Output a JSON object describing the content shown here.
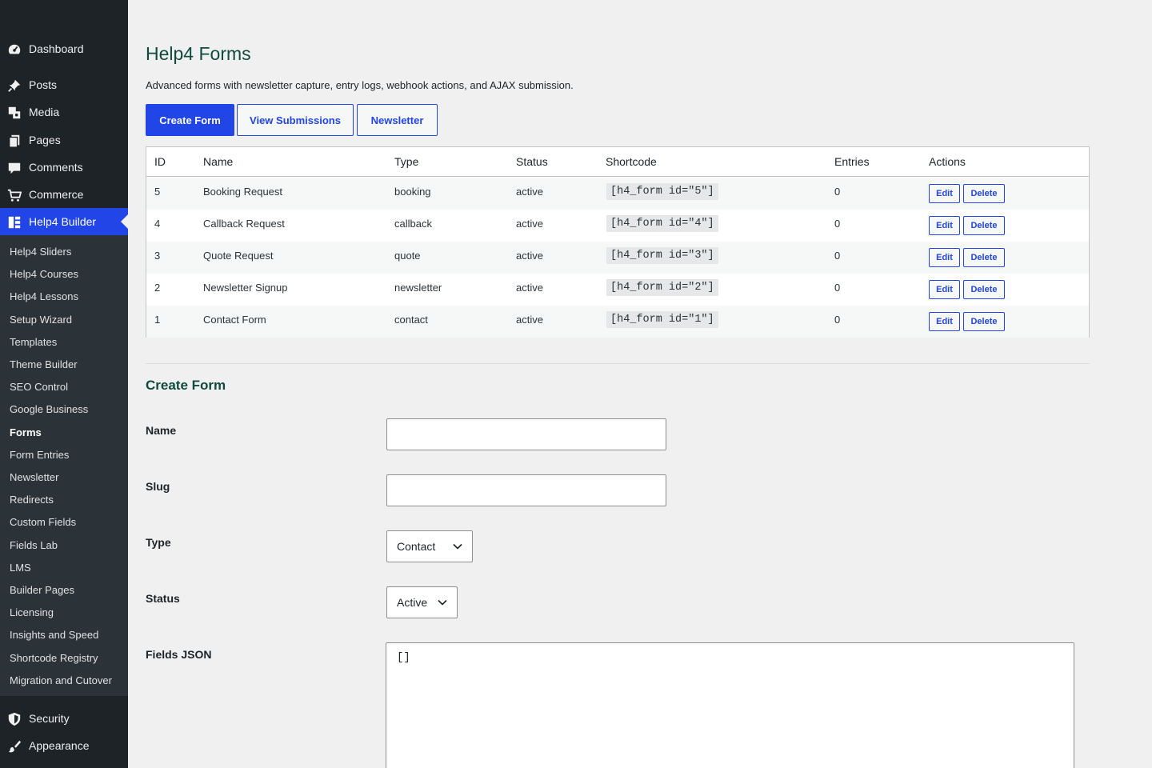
{
  "sidebar": {
    "top_items": [
      {
        "label": "Dashboard",
        "icon": "dashboard-icon"
      },
      {
        "label": "Posts",
        "icon": "pin-icon"
      },
      {
        "label": "Media",
        "icon": "media-icon"
      },
      {
        "label": "Pages",
        "icon": "pages-icon"
      },
      {
        "label": "Comments",
        "icon": "comment-icon"
      },
      {
        "label": "Commerce",
        "icon": "cart-icon"
      },
      {
        "label": "Help4 Builder",
        "icon": "grid-icon"
      }
    ],
    "submenu": [
      "Help4 Sliders",
      "Help4 Courses",
      "Help4 Lessons",
      "Setup Wizard",
      "Templates",
      "Theme Builder",
      "SEO Control",
      "Google Business",
      "Forms",
      "Form Entries",
      "Newsletter",
      "Redirects",
      "Custom Fields",
      "Fields Lab",
      "LMS",
      "Builder Pages",
      "Licensing",
      "Insights and Speed",
      "Shortcode Registry",
      "Migration and Cutover"
    ],
    "current_submenu": "Forms",
    "bottom_items": [
      {
        "label": "Security",
        "icon": "shield-icon"
      },
      {
        "label": "Appearance",
        "icon": "brush-icon"
      }
    ]
  },
  "page": {
    "title": "Help4 Forms",
    "description": "Advanced forms with newsletter capture, entry logs, webhook actions, and AJAX submission.",
    "buttons": {
      "create": "Create Form",
      "submissions": "View Submissions",
      "newsletter": "Newsletter"
    }
  },
  "table": {
    "headers": [
      "ID",
      "Name",
      "Type",
      "Status",
      "Shortcode",
      "Entries",
      "Actions"
    ],
    "rows": [
      {
        "id": "5",
        "name": "Booking Request",
        "type": "booking",
        "status": "active",
        "shortcode": "[h4_form id=\"5\"]",
        "entries": "0"
      },
      {
        "id": "4",
        "name": "Callback Request",
        "type": "callback",
        "status": "active",
        "shortcode": "[h4_form id=\"4\"]",
        "entries": "0"
      },
      {
        "id": "3",
        "name": "Quote Request",
        "type": "quote",
        "status": "active",
        "shortcode": "[h4_form id=\"3\"]",
        "entries": "0"
      },
      {
        "id": "2",
        "name": "Newsletter Signup",
        "type": "newsletter",
        "status": "active",
        "shortcode": "[h4_form id=\"2\"]",
        "entries": "0"
      },
      {
        "id": "1",
        "name": "Contact Form",
        "type": "contact",
        "status": "active",
        "shortcode": "[h4_form id=\"1\"]",
        "entries": "0"
      }
    ],
    "edit_label": "Edit",
    "delete_label": "Delete"
  },
  "create_form": {
    "title": "Create Form",
    "name_label": "Name",
    "name_value": "",
    "slug_label": "Slug",
    "slug_value": "",
    "type_label": "Type",
    "type_value": "Contact",
    "status_label": "Status",
    "status_value": "Active",
    "fields_label": "Fields JSON",
    "fields_value": "[]"
  },
  "colors": {
    "accent": "#2145e6",
    "sidebar_bg": "#1d2327",
    "submenu_bg": "#2c3338",
    "heading": "#0f4a3a"
  }
}
